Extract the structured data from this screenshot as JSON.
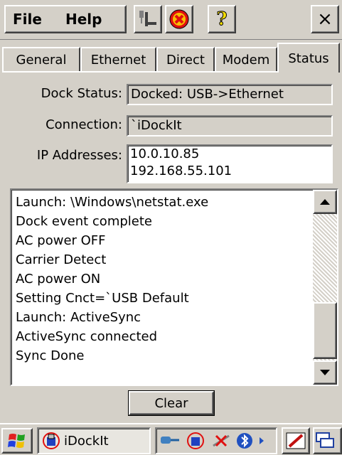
{
  "menu": {
    "file_label": "File",
    "help_label": "Help",
    "close_label": "×"
  },
  "toolbar": {
    "help_glyph": "?"
  },
  "tabs": [
    {
      "label": "General"
    },
    {
      "label": "Ethernet"
    },
    {
      "label": "Direct"
    },
    {
      "label": "Modem"
    },
    {
      "label": "Status"
    }
  ],
  "status": {
    "dock_status_label": "Dock Status:",
    "dock_status_value": "Docked: USB->Ethernet",
    "connection_label": "Connection:",
    "connection_value": "`iDockIt",
    "ip_label": "IP Addresses:",
    "ip_values": [
      "10.0.10.85",
      "192.168.55.101"
    ]
  },
  "log": [
    "Launch: \\Windows\\netstat.exe",
    "Dock event complete",
    "AC power OFF",
    "Carrier Detect",
    "AC power ON",
    "Setting Cnct=`USB Default",
    "Launch: ActiveSync",
    "ActiveSync connected",
    "Sync Done"
  ],
  "clear_label": "Clear",
  "taskbar": {
    "app_label": "iDockIt"
  },
  "colors": {
    "window": "#d4d0c8",
    "field_bg": "#ffffff",
    "stop_red": "#e01010",
    "help_yellow": "#f8e000"
  }
}
